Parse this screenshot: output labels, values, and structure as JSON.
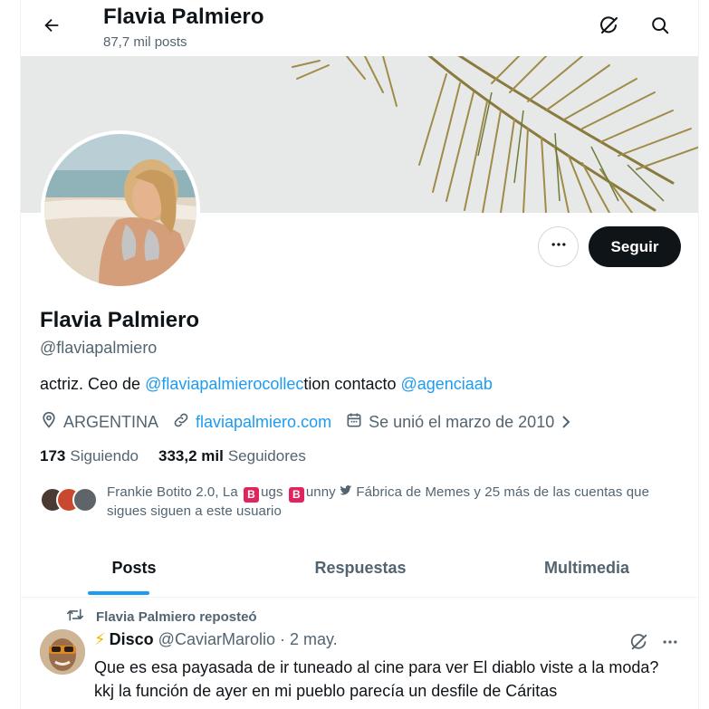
{
  "header": {
    "name": "Flavia Palmiero",
    "posts_count": "87,7 mil posts",
    "icons": [
      "back-arrow-icon",
      "grok-icon",
      "search-icon"
    ]
  },
  "profile": {
    "name": "Flavia Palmiero",
    "handle": "@flaviapalmiero",
    "bio_prefix": "actriz. Ceo de ",
    "bio_link1": "@flaviapalmierocollec",
    "bio_middle": "tion contacto ",
    "bio_link2": "@agenciaab",
    "location": "ARGENTINA",
    "website": "flaviapalmiero.com",
    "joined": "Se unió el marzo de 2010",
    "following_count": "173",
    "following_label": "Siguiendo",
    "followers_count": "333,2 mil",
    "followers_label": "Seguidores",
    "followed_by": {
      "part1": "Frankie Botito 2.0, La ",
      "badge": "B",
      "part2": "ugs ",
      "part3": "unny",
      "part4": " Fábrica de Memes y 25 más de las cuentas que sigues siguen a este usuario"
    }
  },
  "actions": {
    "more_label": "···",
    "follow_label": "Seguir"
  },
  "tabs": [
    {
      "label": "Posts",
      "active": true
    },
    {
      "label": "Respuestas",
      "active": false
    },
    {
      "label": "Multimedia",
      "active": false
    }
  ],
  "post": {
    "repost_label": "Flavia Palmiero reposteó",
    "author_emoji": "⚡",
    "author": "Disco",
    "handle": "@CaviarMarolio",
    "dot": "·",
    "date": "2 may.",
    "text": "Que es esa payasada de ir tuneado al cine para ver El diablo viste a la moda? kkj la función de ayer en mi pueblo parecía un desfile de Cáritas"
  },
  "colors": {
    "accent": "#1d9bf0",
    "text": "#0f1419",
    "secondary": "#536471",
    "follow_bg": "#0f1419",
    "badge": "#e0245e"
  }
}
